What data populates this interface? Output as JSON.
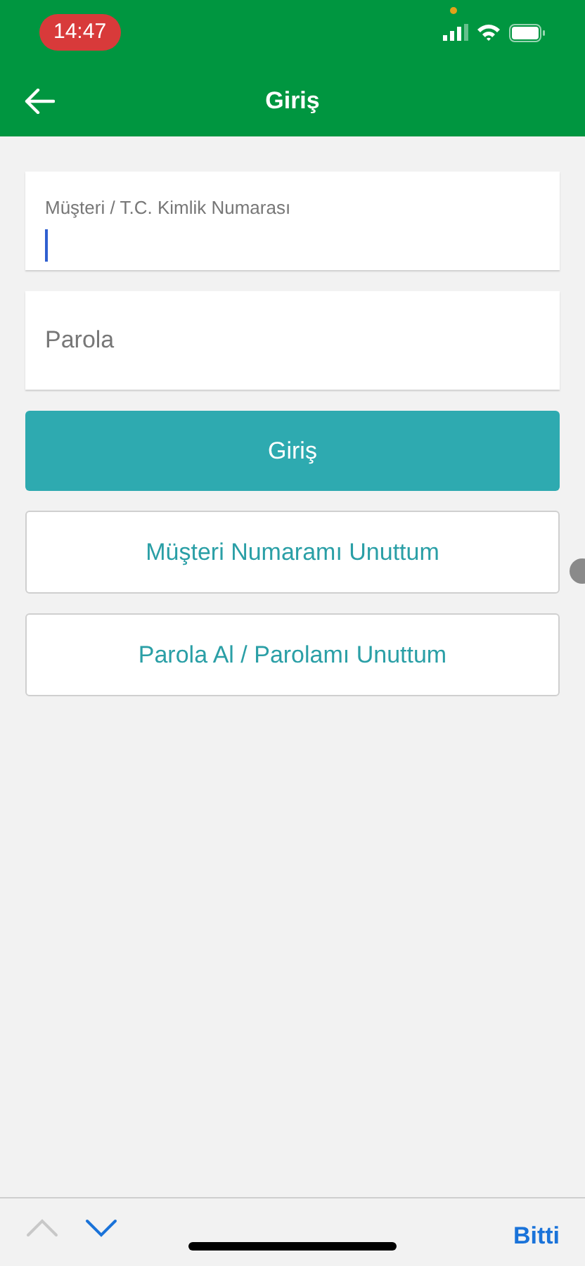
{
  "status_bar": {
    "time": "14:47",
    "recording": true
  },
  "nav": {
    "title": "Giriş"
  },
  "fields": [
    {
      "label": "Müşteri / T.C. Kimlik Numarası",
      "focused": true
    },
    {
      "placeholder": "Parola",
      "focused": false
    }
  ],
  "buttons": [
    {
      "label": "Giriş",
      "kind": "primary"
    },
    {
      "label": "Müşteri Numaramı Unuttum",
      "kind": "secondary"
    },
    {
      "label": "Parola Al / Parolamı Unuttum",
      "kind": "secondary"
    }
  ],
  "keyboard_toolbar": {
    "previous_disabled": true,
    "next_disabled": false,
    "done": "Bitti"
  }
}
